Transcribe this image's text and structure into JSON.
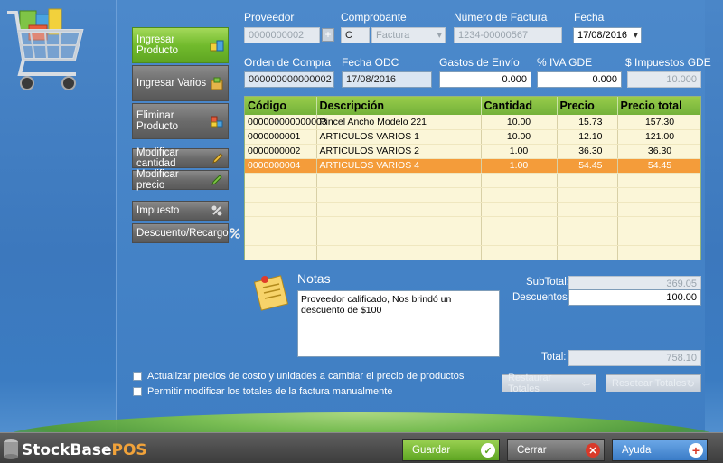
{
  "colors": {
    "accent_green": "#72bb2d",
    "selected_row": "#f49c3a",
    "panel_blue": "#3f7ec3",
    "bottom_bar": "#444444"
  },
  "header": {
    "proveedor_label": "Proveedor",
    "proveedor_value": "0000000002",
    "comprobante_label": "Comprobante",
    "comprobante_letter": "C",
    "comprobante_type": "Factura",
    "numero_label": "Número de Factura",
    "numero_value": "1234-00000567",
    "fecha_label": "Fecha",
    "fecha_value": "17/08/2016",
    "orden_label": "Orden de Compra",
    "orden_value": "000000000000002",
    "fecha_odc_label": "Fecha ODC",
    "fecha_odc_value": "17/08/2016",
    "gastos_label": "Gastos de Envío",
    "gastos_value": "0.000",
    "iva_label": "% IVA GDE",
    "iva_value": "0.000",
    "impuestos_label": "$ Impuestos GDE",
    "impuestos_value": "10.000"
  },
  "sidebar": {
    "ingresar_producto": "Ingresar Producto",
    "ingresar_varios": "Ingresar Varios",
    "eliminar_producto": "Eliminar Producto",
    "modificar_cantidad": "Modificar cantidad",
    "modificar_precio": "Modificar precio",
    "impuesto": "Impuesto",
    "descuento": "Descuento/Recargo"
  },
  "table": {
    "columns": [
      "Código",
      "Descripción",
      "Cantidad",
      "Precio",
      "Precio total"
    ],
    "rows": [
      [
        "000000000000003",
        "Pincel Ancho Modelo 221",
        "10.00",
        "15.73",
        "157.30"
      ],
      [
        "0000000001",
        "ARTICULOS VARIOS 1",
        "10.00",
        "12.10",
        "121.00"
      ],
      [
        "0000000002",
        "ARTICULOS VARIOS 2",
        "1.00",
        "36.30",
        "36.30"
      ],
      [
        "0000000004",
        "ARTICULOS VARIOS 4",
        "1.00",
        "54.45",
        "54.45"
      ]
    ],
    "selected_row": 3
  },
  "notes": {
    "title": "Notas",
    "text": "Proveedor calificado, Nos brindó un descuento de $100"
  },
  "totals": {
    "subtotal_label": "SubTotal:",
    "subtotal_value": "369.05",
    "descuentos_label": "Descuentos:",
    "descuentos_value": "100.00",
    "total_label": "Total:",
    "total_value": "758.10"
  },
  "options": {
    "actualizar_label": "Actualizar precios de costo y unidades a cambiar el precio de productos",
    "permitir_label": "Permitir modificar los totales de la factura manualmente"
  },
  "actions": {
    "restaurar": "Restaurar Totales",
    "resetear": "Resetear Totales"
  },
  "footer": {
    "brand_stock": "StockBase",
    "brand_pos": "POS",
    "guardar": "Guardar",
    "cerrar": "Cerrar",
    "ayuda": "Ayuda"
  }
}
